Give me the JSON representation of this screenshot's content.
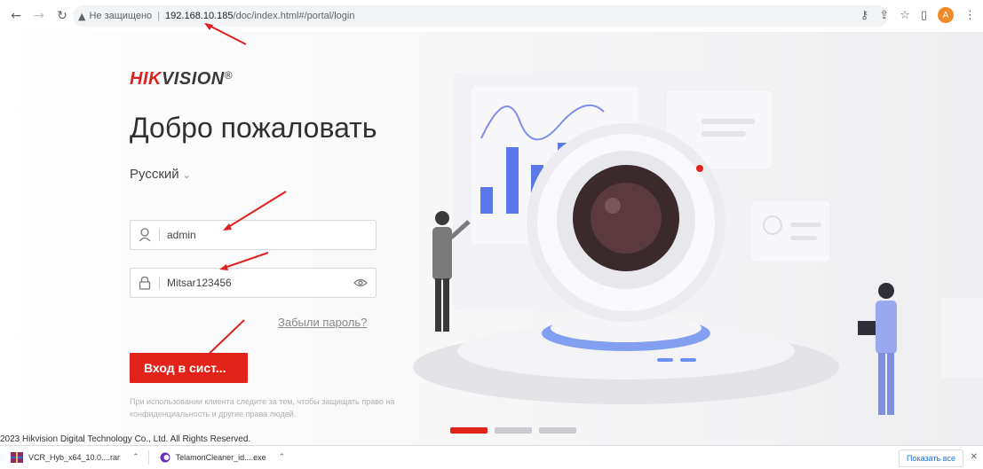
{
  "browser": {
    "security_text": "Не защищено",
    "url_host": "192.168.10.185",
    "url_path": "/doc/index.html#/portal/login",
    "profile_initial": "A",
    "icons": [
      "back-icon",
      "forward-icon",
      "reload-icon",
      "key-icon",
      "share-icon",
      "star-icon",
      "sidepanel-icon",
      "menu-icon"
    ]
  },
  "login": {
    "brand_hik": "HIK",
    "brand_vision": "VISION",
    "brand_reg": "®",
    "welcome": "Добро пожаловать",
    "language": "Русский",
    "username": "admin",
    "password": "Mitsar123456",
    "forgot": "Забыли пароль?",
    "submit": "Вход в сист...",
    "notice": "При использовании клиента следите за тем, чтобы защищать право на конфиденциальность и другие права людей.",
    "copyright": "2023 Hikvision Digital Technology Co., Ltd. All Rights Reserved.",
    "carousel_active": 0,
    "carousel_count": 3
  },
  "downloads": {
    "items": [
      "VCR_Hyb_x64_10.0....rar",
      "TelamonCleaner_id....exe"
    ],
    "show_all": "Показать все"
  },
  "colors": {
    "brand_red": "#e2231a",
    "accent_blue": "#5b78e8"
  }
}
